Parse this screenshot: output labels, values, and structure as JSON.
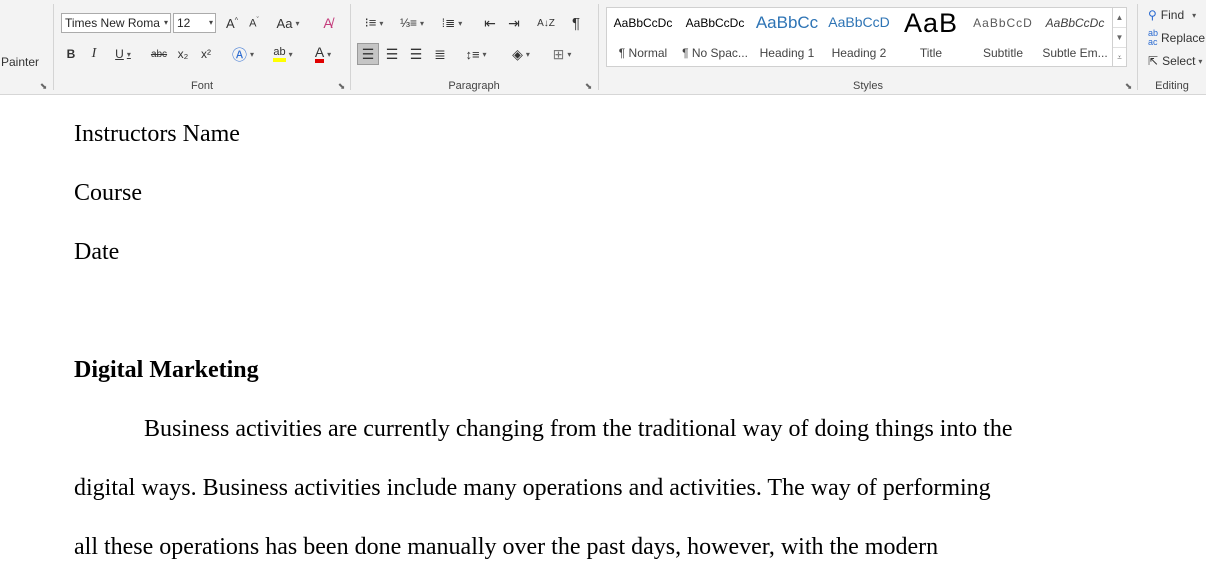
{
  "ribbon": {
    "clipboard": {
      "painter_label": "Painter"
    },
    "font": {
      "group_label": "Font",
      "font_name": "Times New Roma",
      "font_size": "12",
      "change_case": "Aa",
      "bold": "B",
      "italic": "I",
      "underline": "U",
      "strike": "abc",
      "subscript": "x₂",
      "superscript": "x²",
      "highlight": "ab",
      "font_color": "A"
    },
    "paragraph": {
      "group_label": "Paragraph",
      "sort": "A↓Z",
      "pilcrow": "¶"
    },
    "styles": {
      "group_label": "Styles",
      "items": [
        {
          "preview": "AaBbCcDc",
          "name": "¶ Normal"
        },
        {
          "preview": "AaBbCcDc",
          "name": "¶ No Spac..."
        },
        {
          "preview": "AaBbCc",
          "name": "Heading 1"
        },
        {
          "preview": "AaBbCcD",
          "name": "Heading 2"
        },
        {
          "preview": "AaB",
          "name": "Title"
        },
        {
          "preview": "AaBbCcD",
          "name": "Subtitle"
        },
        {
          "preview": "AaBbCcDc",
          "name": "Subtle Em..."
        }
      ]
    },
    "editing": {
      "group_label": "Editing",
      "find": "Find",
      "replace": "Replace",
      "select": "Select"
    }
  },
  "document": {
    "line1": "Instructors Name",
    "line2": "Course",
    "line3": "Date",
    "heading": "Digital Marketing",
    "body_line1": "Business activities are currently changing from the traditional way of doing things into the",
    "body_line2": "digital ways. Business activities include many operations and activities. The way of performing",
    "body_line3": "all these operations has been done manually over the past days, however, with the modern"
  },
  "colors": {
    "ribbon_bg": "#f3f3f3",
    "heading_blue": "#2e74b5",
    "highlight_yellow": "#ffff00",
    "font_red": "#e00000"
  }
}
